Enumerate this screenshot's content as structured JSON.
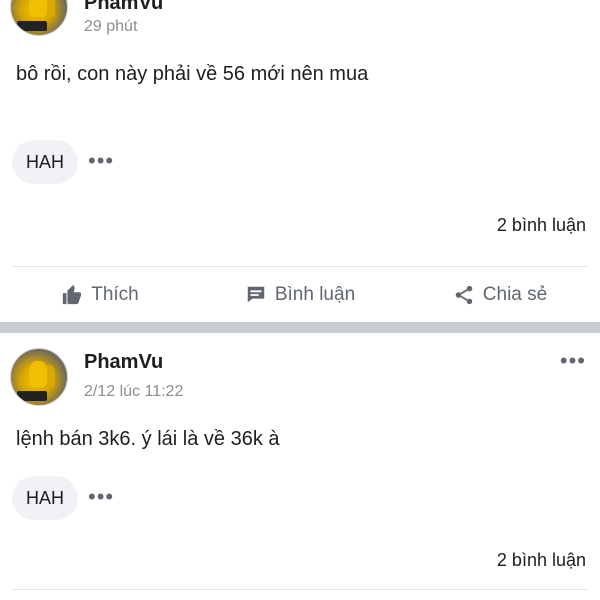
{
  "posts": [
    {
      "author": "PhamVu",
      "time": "29 phút",
      "text": "bô rồi, con này phải về 56 mới nên mua",
      "tag": "HAH",
      "comments": "2 bình luận",
      "avatar_icon": "avatar-photo"
    },
    {
      "author": "PhamVu",
      "time": "2/12 lúc 11:22",
      "text": "lệnh bán 3k6. ý lái là về 36k à",
      "tag": "HAH",
      "comments": "2 bình luận",
      "avatar_icon": "avatar-photo"
    }
  ],
  "actions": {
    "like": "Thích",
    "comment": "Bình luận",
    "share": "Chia sẻ"
  },
  "icons": {
    "more": "more-dots-icon",
    "like": "thumbs-up-icon",
    "comment": "comment-icon",
    "share": "share-icon"
  },
  "colors": {
    "text": "#1c1e21",
    "muted": "#8a8d91",
    "action": "#606770",
    "pill_bg": "#f0f2f5",
    "separator": "#c9ccd1"
  }
}
